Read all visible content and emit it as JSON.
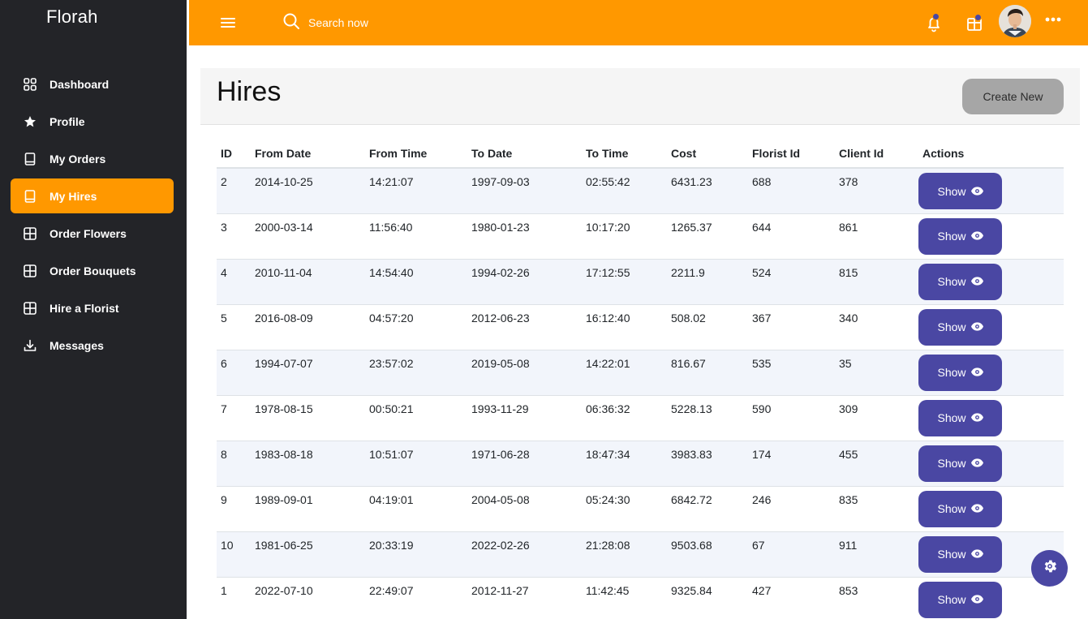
{
  "app": {
    "brand": "Florah"
  },
  "sidebar": {
    "items": [
      {
        "label": "Dashboard",
        "icon": "grid-icon",
        "active": false
      },
      {
        "label": "Profile",
        "icon": "star-icon",
        "active": false
      },
      {
        "label": "My Orders",
        "icon": "book-icon",
        "active": false
      },
      {
        "label": "My Hires",
        "icon": "book-icon",
        "active": true
      },
      {
        "label": "Order Flowers",
        "icon": "table-icon",
        "active": false
      },
      {
        "label": "Order Bouquets",
        "icon": "table-icon",
        "active": false
      },
      {
        "label": "Hire a Florist",
        "icon": "table-icon",
        "active": false
      },
      {
        "label": "Messages",
        "icon": "download-icon",
        "active": false
      }
    ]
  },
  "topbar": {
    "search_placeholder": "Search now",
    "icons": [
      "menu-icon",
      "search-icon",
      "bell-icon",
      "gift-icon",
      "avatar",
      "more-icon"
    ]
  },
  "page": {
    "title": "Hires",
    "create_label": "Create New"
  },
  "table": {
    "columns": [
      "ID",
      "From Date",
      "From Time",
      "To Date",
      "To Time",
      "Cost",
      "Florist Id",
      "Client Id",
      "Actions"
    ],
    "rows": [
      [
        "2",
        "2014-10-25",
        "14:21:07",
        "1997-09-03",
        "02:55:42",
        "6431.23",
        "688",
        "378"
      ],
      [
        "3",
        "2000-03-14",
        "11:56:40",
        "1980-01-23",
        "10:17:20",
        "1265.37",
        "644",
        "861"
      ],
      [
        "4",
        "2010-11-04",
        "14:54:40",
        "1994-02-26",
        "17:12:55",
        "2211.9",
        "524",
        "815"
      ],
      [
        "5",
        "2016-08-09",
        "04:57:20",
        "2012-06-23",
        "16:12:40",
        "508.02",
        "367",
        "340"
      ],
      [
        "6",
        "1994-07-07",
        "23:57:02",
        "2019-05-08",
        "14:22:01",
        "816.67",
        "535",
        "35"
      ],
      [
        "7",
        "1978-08-15",
        "00:50:21",
        "1993-11-29",
        "06:36:32",
        "5228.13",
        "590",
        "309"
      ],
      [
        "8",
        "1983-08-18",
        "10:51:07",
        "1971-06-28",
        "18:47:34",
        "3983.83",
        "174",
        "455"
      ],
      [
        "9",
        "1989-09-01",
        "04:19:01",
        "2004-05-08",
        "05:24:30",
        "6842.72",
        "246",
        "835"
      ],
      [
        "10",
        "1981-06-25",
        "20:33:19",
        "2022-02-26",
        "21:28:08",
        "9503.68",
        "67",
        "911"
      ],
      [
        "1",
        "2022-07-10",
        "22:49:07",
        "2012-11-27",
        "11:42:45",
        "9325.84",
        "427",
        "853"
      ]
    ],
    "action_label": "Show"
  },
  "colors": {
    "accent": "#ff9800",
    "sidebar_bg": "#232428",
    "button": "#4a47a3",
    "create_button": "#a6a6a6",
    "stripe": "#f2f5fb"
  }
}
